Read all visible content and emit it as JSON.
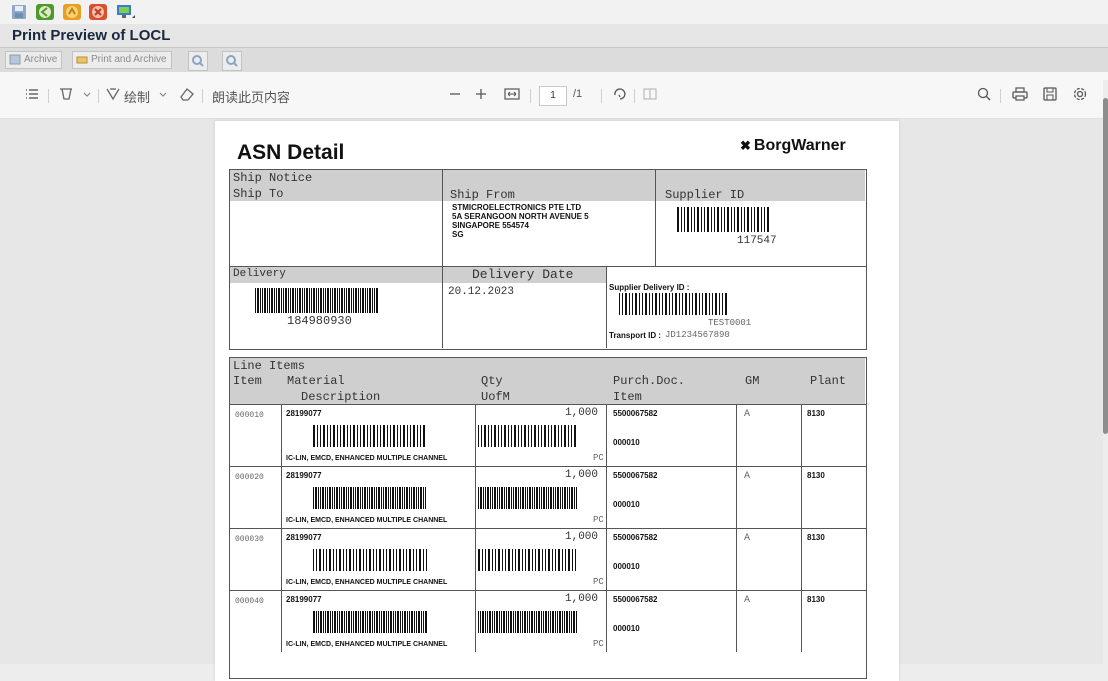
{
  "window": {
    "title": "Print Preview of LOCL"
  },
  "sap_toolbar": {
    "icons": [
      "save-icon",
      "back-icon",
      "exit-icon",
      "cancel-icon",
      "display-icon"
    ],
    "colors": {
      "save": "#8fa8c8",
      "back": "#4c9a2a",
      "exit": "#e8a020",
      "cancel": "#d9502f"
    }
  },
  "app_toolbar": {
    "archive": "Archive",
    "print_and_archive": "Print and Archive",
    "icons": [
      "search-icon",
      "search-next-icon"
    ]
  },
  "pdf_toolbar": {
    "read_aloud": "朗读此页内容",
    "draw": "绘制",
    "page_current": "1",
    "page_total": "/1",
    "icons": [
      "contents-icon",
      "highlight-icon",
      "draw-icon",
      "eraser-icon",
      "zoom-out-icon",
      "zoom-in-icon",
      "fit-page-icon",
      "rotate-icon",
      "page-view-icon",
      "search-icon",
      "print-icon",
      "save-icon",
      "settings-icon"
    ]
  },
  "document": {
    "title": "ASN Detail",
    "logo_text": "BorgWarner",
    "ship_notice": "Ship Notice",
    "ship_to": "Ship To",
    "ship_from": "Ship From",
    "supplier_id_label": "Supplier ID",
    "supplier_id": "117547",
    "ship_from_address": [
      "STMICROELECTRONICS PTE LTD",
      "5A SERANGOON NORTH AVENUE 5",
      "SINGAPORE  554574",
      "SG"
    ],
    "delivery_label": "Delivery",
    "delivery_number": "184980930",
    "delivery_date_label": "Delivery Date",
    "delivery_date": "20.12.2023",
    "supplier_delivery_id_label": "Supplier Delivery ID :",
    "supplier_delivery_id": "TEST0001",
    "transport_id_label": "Transport ID :",
    "transport_id": "JD1234567890",
    "line_items": {
      "section_label": "Line Items",
      "headers": {
        "item": "Item",
        "material": "Material",
        "description": "Description",
        "qty": "Qty",
        "uofm": "UofM",
        "purch_doc": "Purch.Doc.",
        "purch_item": "Item",
        "gm": "GM",
        "plant": "Plant"
      },
      "rows": [
        {
          "item": "000010",
          "material": "28199077",
          "description": "IC-LIN, EMCD, ENHANCED MULTIPLE CHANNEL",
          "qty": "1,000",
          "uofm": "PC",
          "purch_doc": "5500067582",
          "purch_item": "000010",
          "gm": "A",
          "plant": "8130"
        },
        {
          "item": "000020",
          "material": "28199077",
          "description": "IC-LIN, EMCD, ENHANCED MULTIPLE CHANNEL",
          "qty": "1,000",
          "uofm": "PC",
          "purch_doc": "5500067582",
          "purch_item": "000010",
          "gm": "A",
          "plant": "8130"
        },
        {
          "item": "000030",
          "material": "28199077",
          "description": "IC-LIN, EMCD, ENHANCED MULTIPLE CHANNEL",
          "qty": "1,000",
          "uofm": "PC",
          "purch_doc": "5500067582",
          "purch_item": "000010",
          "gm": "A",
          "plant": "8130"
        },
        {
          "item": "000040",
          "material": "28199077",
          "description": "IC-LIN, EMCD, ENHANCED MULTIPLE CHANNEL",
          "qty": "1,000",
          "uofm": "PC",
          "purch_doc": "5500067582",
          "purch_item": "000010",
          "gm": "A",
          "plant": "8130"
        }
      ]
    }
  }
}
